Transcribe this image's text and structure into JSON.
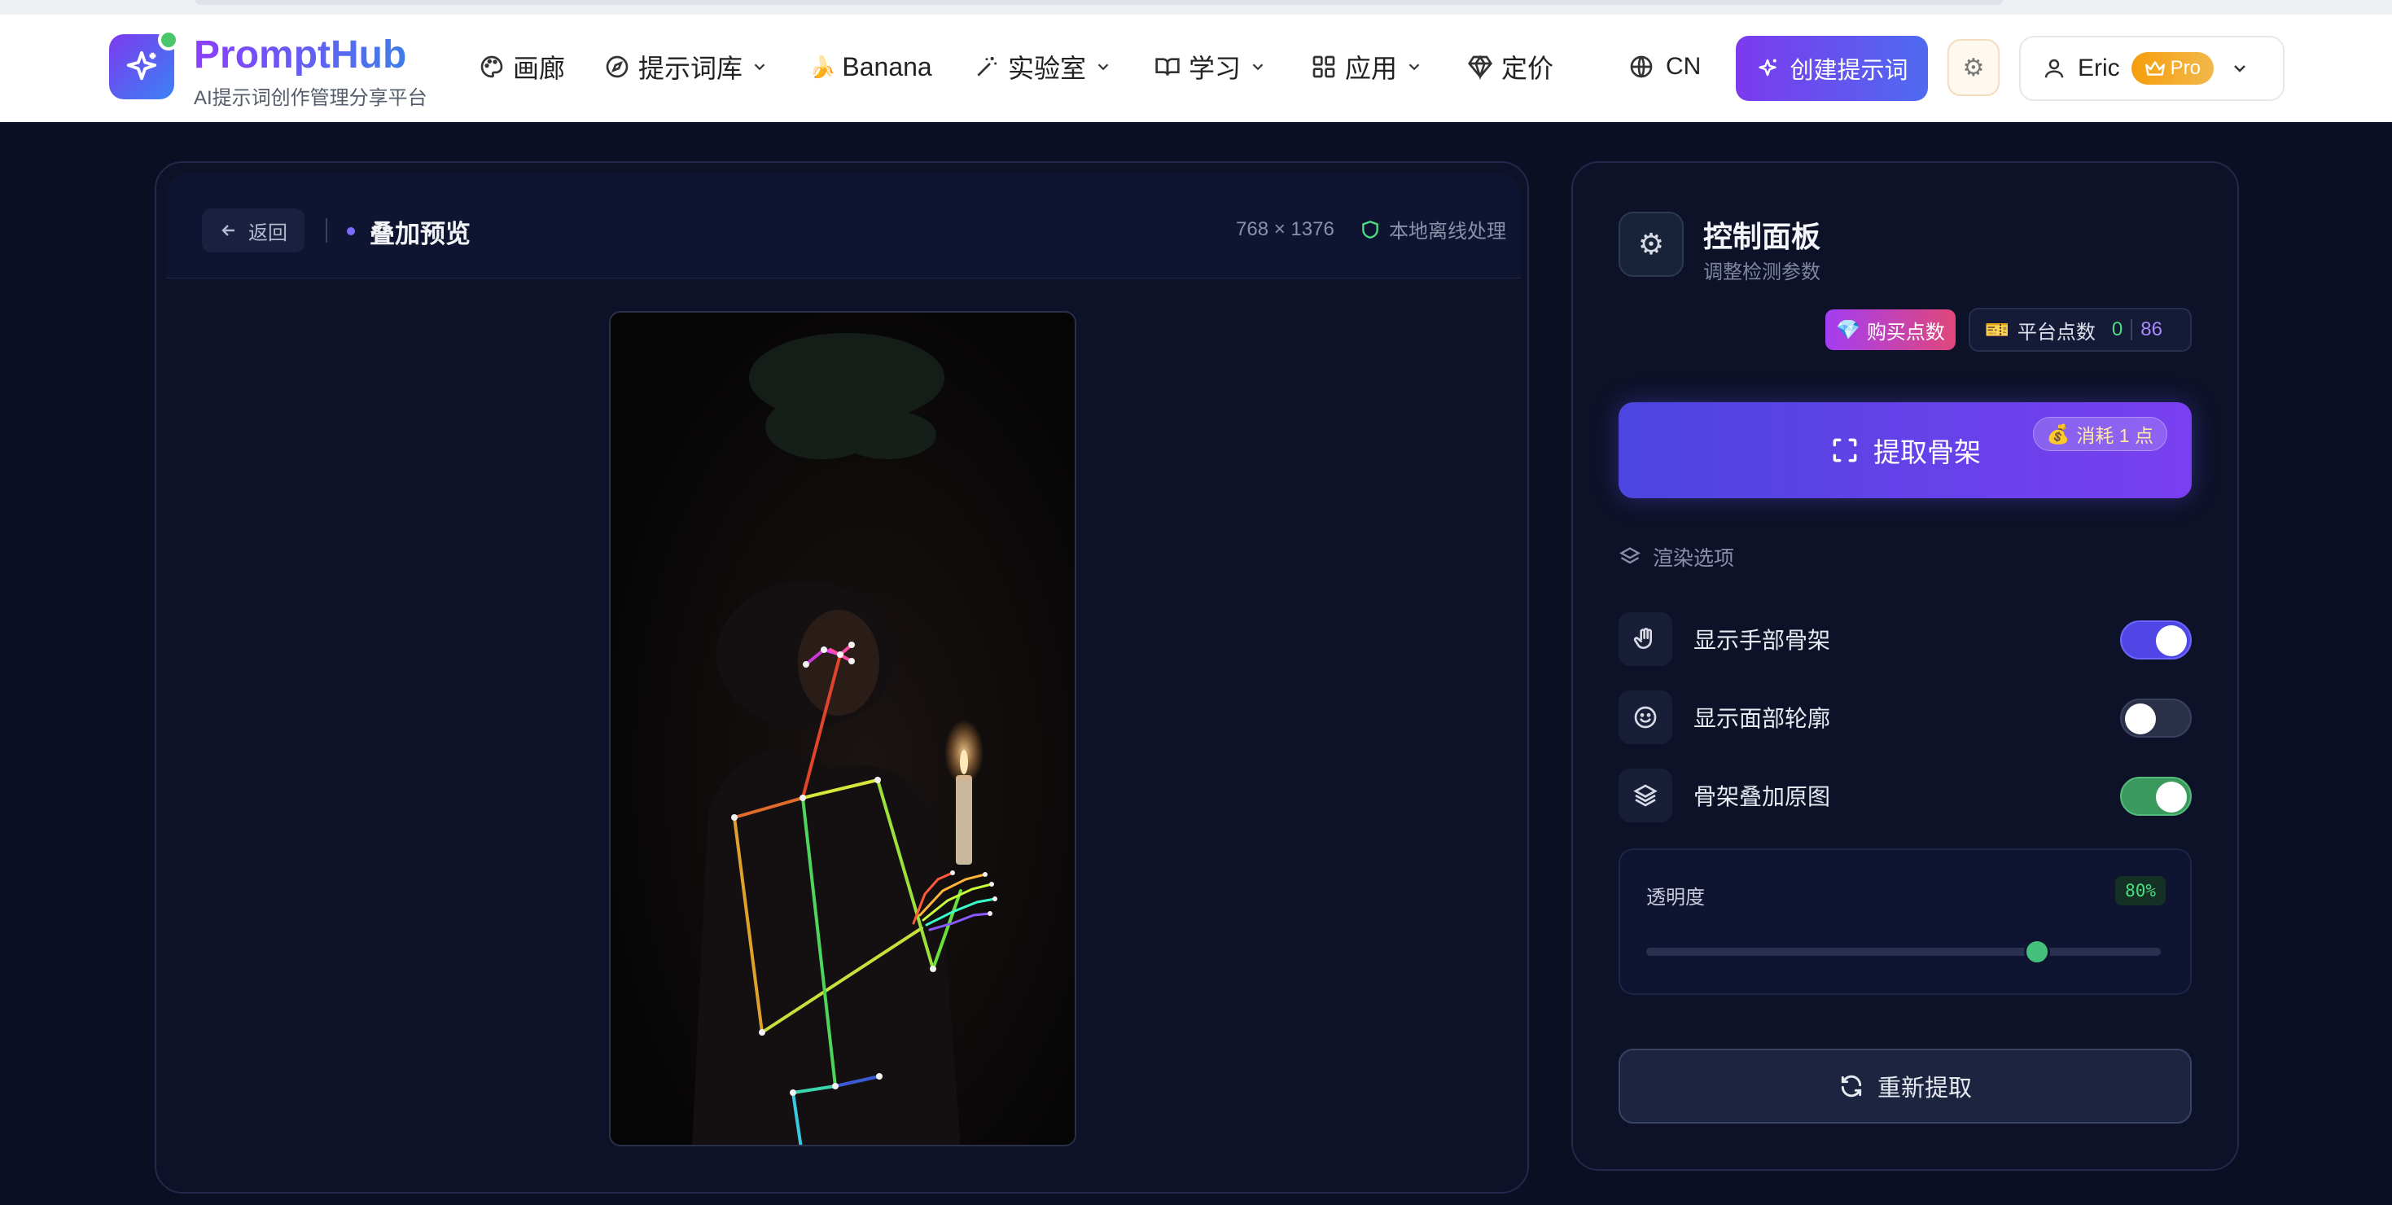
{
  "app": {
    "brand": "PromptHub",
    "tagline": "AI提示词创作管理分享平台"
  },
  "nav": {
    "items": [
      {
        "label": "画廊",
        "icon": "palette-icon",
        "dropdown": false
      },
      {
        "label": "提示词库",
        "icon": "compass-icon",
        "dropdown": true
      },
      {
        "label": "Banana",
        "icon": "banana-icon",
        "dropdown": false
      },
      {
        "label": "实验室",
        "icon": "magic-wand-icon",
        "dropdown": true
      },
      {
        "label": "学习",
        "icon": "book-icon",
        "dropdown": true
      },
      {
        "label": "应用",
        "icon": "grid-icon",
        "dropdown": true
      },
      {
        "label": "定价",
        "icon": "diamond-icon",
        "dropdown": false
      }
    ],
    "language": "CN",
    "create_button": "创建提示词",
    "user": {
      "name": "Eric",
      "badge": "Pro"
    }
  },
  "preview": {
    "back_label": "返回",
    "title": "叠加预览",
    "dimensions": "768 × 1376",
    "offline_label": "本地离线处理"
  },
  "control": {
    "title": "控制面板",
    "subtitle": "调整检测参数",
    "buy_label": "购买点数",
    "credits_label": "平台点数",
    "credits_value": "0",
    "credits_total": "86",
    "extract_label": "提取骨架",
    "cost_label": "消耗 1 点",
    "section_label": "渲染选项",
    "options": [
      {
        "label": "显示手部骨架",
        "icon": "hand-icon",
        "enabled": true
      },
      {
        "label": "显示面部轮廓",
        "icon": "smile-icon",
        "enabled": false
      },
      {
        "label": "骨架叠加原图",
        "icon": "layers-icon",
        "enabled": true
      }
    ],
    "opacity_label": "透明度",
    "opacity_value": "80%",
    "opacity_level": 0.76,
    "reextract_label": "重新提取"
  },
  "colors": {
    "accent": "#6d4cf0",
    "green": "#43c07a",
    "pro": "#f59e0b"
  }
}
